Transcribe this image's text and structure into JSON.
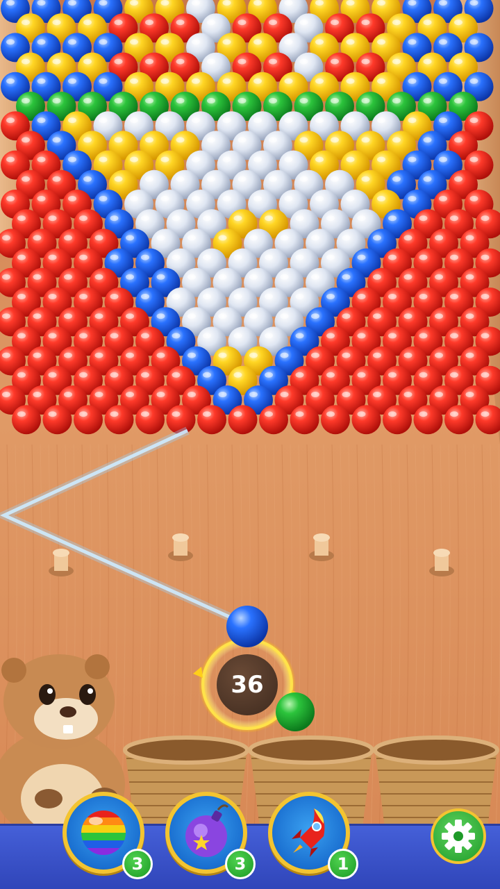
{
  "game": {
    "shots_remaining": "36",
    "current_ball_color": "blue",
    "next_ball_color": "green",
    "ball_colors": {
      "red": "#e8231c",
      "yellow": "#f6c812",
      "blue": "#1f5fe6",
      "green": "#21a83a",
      "clear": "#cfd8e6"
    }
  },
  "boosters": [
    {
      "name": "rainbow-ball",
      "icon": "rainbow-ball-icon",
      "count": "3"
    },
    {
      "name": "bomb",
      "icon": "bomb-icon",
      "count": "3"
    },
    {
      "name": "rocket",
      "icon": "rocket-icon",
      "count": "1"
    }
  ],
  "settings": {
    "icon": "gear-icon"
  },
  "colors": {
    "wood": "#d98c55",
    "bar": "#3a52c8",
    "ring": "#f3c431"
  }
}
